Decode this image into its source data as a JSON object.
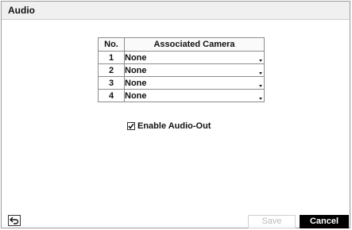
{
  "window": {
    "title": "Audio"
  },
  "table": {
    "headers": {
      "no": "No.",
      "camera": "Associated Camera"
    },
    "rows": [
      {
        "no": "1",
        "camera": "None"
      },
      {
        "no": "2",
        "camera": "None"
      },
      {
        "no": "3",
        "camera": "None"
      },
      {
        "no": "4",
        "camera": "None"
      }
    ]
  },
  "audio_out": {
    "label": "Enable Audio-Out",
    "checked": true
  },
  "footer": {
    "back_icon": "back-arrow-icon",
    "save_label": "Save",
    "cancel_label": "Cancel"
  }
}
